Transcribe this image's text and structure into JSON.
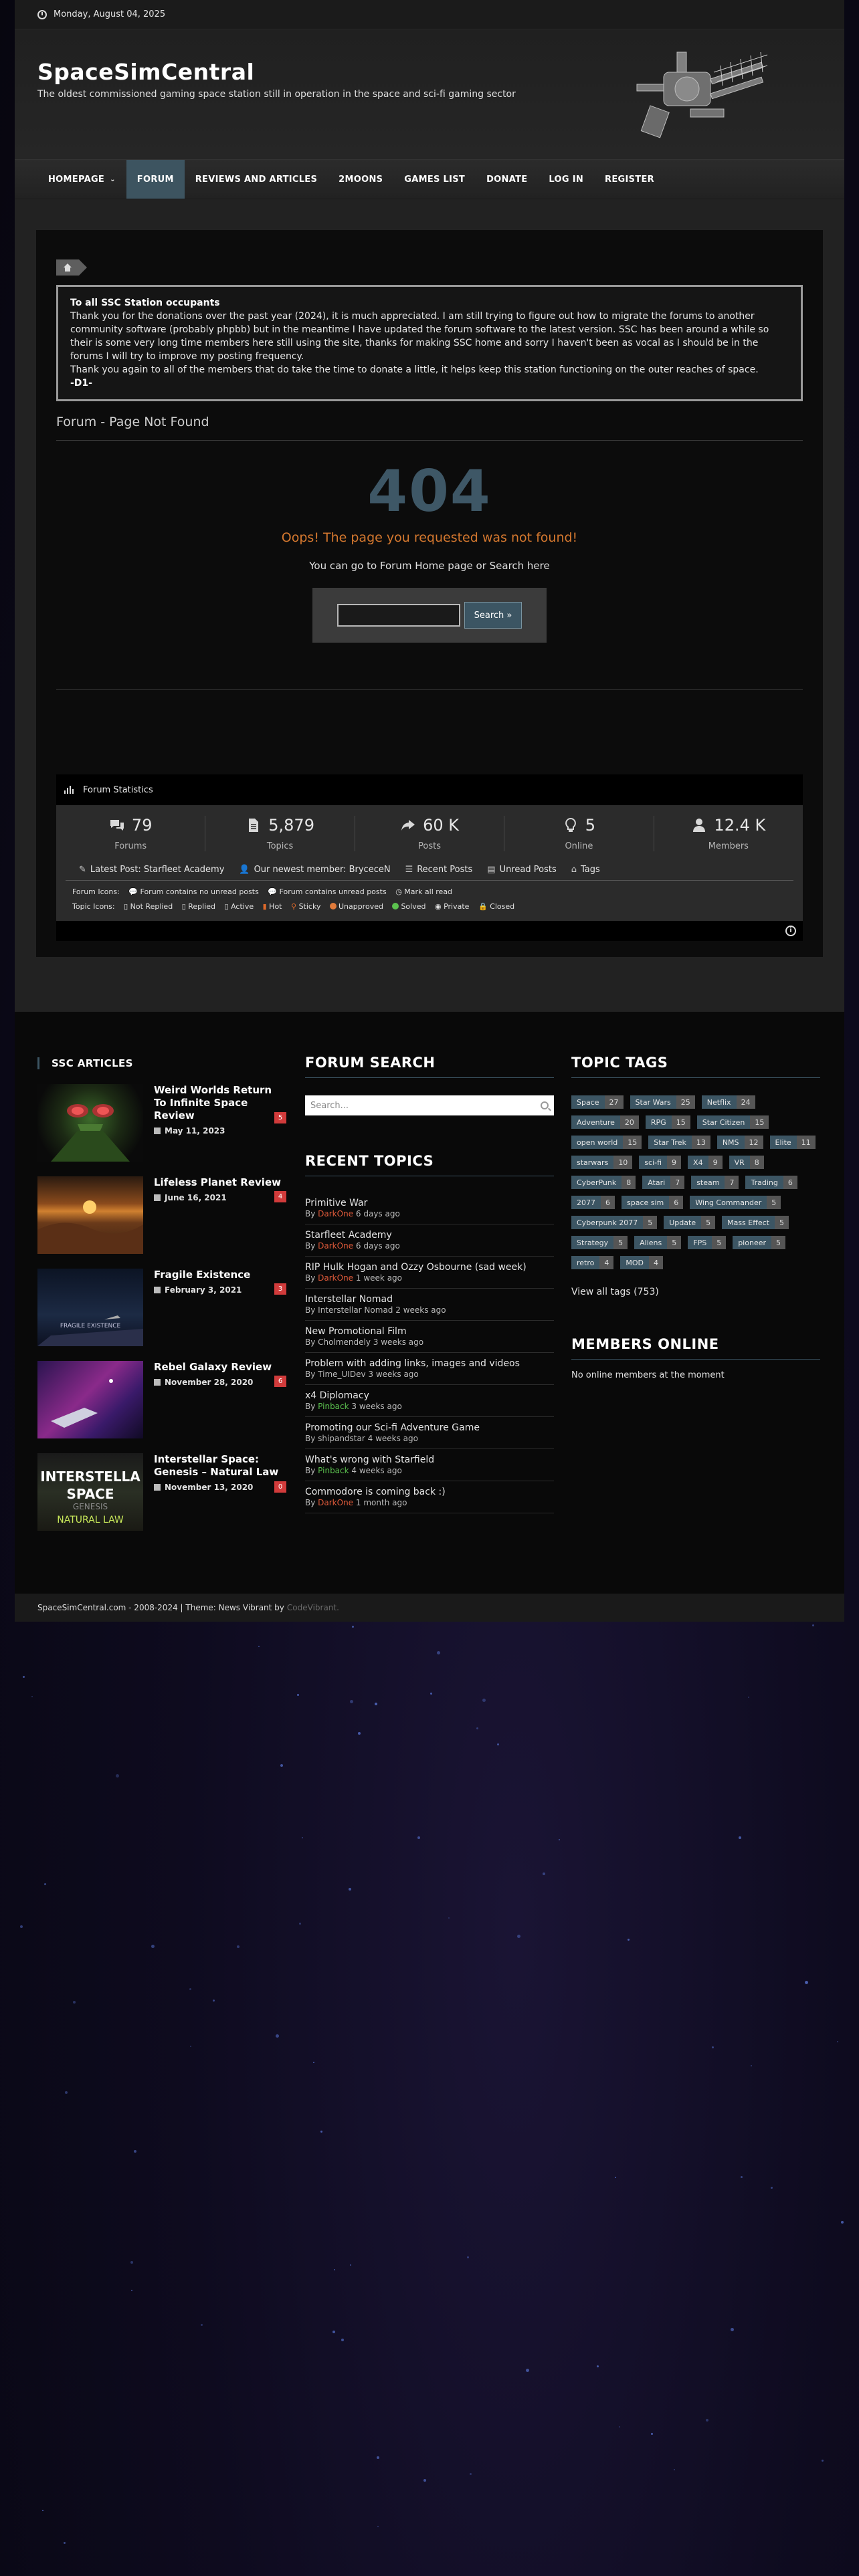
{
  "topbar": {
    "date": "Monday, August 04, 2025"
  },
  "header": {
    "title": "SpaceSimCentral",
    "tagline": "The oldest commissioned gaming space station still in operation in the space and sci-fi gaming sector"
  },
  "nav": {
    "items": [
      "HOMEPAGE",
      "FORUM",
      "REVIEWS AND ARTICLES",
      "2MOONS",
      "GAMES LIST",
      "DONATE",
      "LOG IN",
      "REGISTER"
    ]
  },
  "notice": {
    "heading": "To all SSC Station occupants",
    "body": "Thank you for the donations over the past year (2024), it is much appreciated. I am still trying to figure out how to migrate the forums to another community software (probably phpbb) but in the meantime I have updated the forum software to the latest version. SSC has been around a while so their is some very long time members here still using the site, thanks for making SSC home and sorry I haven't been as vocal as I should be in the forums I will try to improve my posting frequency.",
    "thanks": "Thank you again to all of the members that do take the time to donate a little, it helps keep this station functioning on the outer reaches of space.",
    "signature": "-D1-"
  },
  "not_found": {
    "heading": "Forum - Page Not Found",
    "code": "404",
    "oops": "Oops! The page you requested was not found!",
    "help": "You can go to Forum Home page or Search here",
    "search_button": "Search »"
  },
  "stats": {
    "title": "Forum Statistics",
    "items": [
      {
        "value": "79",
        "label": "Forums"
      },
      {
        "value": "5,879",
        "label": "Topics"
      },
      {
        "value": "60 K",
        "label": "Posts"
      },
      {
        "value": "5",
        "label": "Online"
      },
      {
        "value": "12.4 K",
        "label": "Members"
      }
    ],
    "latest_post": "Latest Post: Starfleet Academy",
    "newest_member": "Our newest member: BryceceN",
    "recent_posts": "Recent Posts",
    "unread_posts": "Unread Posts",
    "tags": "Tags",
    "forum_icons_label": "Forum Icons:",
    "forum_no_unread": "Forum contains no unread posts",
    "forum_unread": "Forum contains unread posts",
    "mark_all_read": "Mark all read",
    "topic_icons_label": "Topic Icons:",
    "topic_icons": [
      "Not Replied",
      "Replied",
      "Active",
      "Hot",
      "Sticky",
      "Unapproved",
      "Solved",
      "Private",
      "Closed"
    ]
  },
  "articles": {
    "title": "SSC ARTICLES",
    "items": [
      {
        "title": "Weird Worlds Return To Infinite Space Review",
        "date": "May 11, 2023",
        "count": "5"
      },
      {
        "title": "Lifeless Planet Review",
        "date": "June 16, 2021",
        "count": "4"
      },
      {
        "title": "Fragile Existence",
        "date": "February 3, 2021",
        "count": "3"
      },
      {
        "title": "Rebel Galaxy Review",
        "date": "November 28, 2020",
        "count": "6"
      },
      {
        "title": "Interstellar Space: Genesis – Natural Law",
        "date": "November 13, 2020",
        "count": "0"
      }
    ],
    "thumb_texts": {
      "fragile": "FRAGILE EXISTENCE",
      "interstellar_1": "INTERSTELLA",
      "interstellar_2": "SPACE",
      "interstellar_3": "GENESIS",
      "interstellar_4": "NATURAL LAW"
    }
  },
  "forum_search": {
    "title": "FORUM SEARCH",
    "placeholder": "Search..."
  },
  "recent_topics": {
    "title": "RECENT TOPICS",
    "items": [
      {
        "title": "Primitive War",
        "author": "DarkOne",
        "ago": "6 days ago",
        "color": "#e05a3a"
      },
      {
        "title": "Starfleet Academy",
        "author": "DarkOne",
        "ago": "6 days ago",
        "color": "#e05a3a"
      },
      {
        "title": "RIP Hulk Hogan and Ozzy Osbourne (sad week)",
        "author": "DarkOne",
        "ago": "1 week ago",
        "color": "#e05a3a"
      },
      {
        "title": "Interstellar Nomad",
        "author": "Interstellar Nomad",
        "ago": "2 weeks ago",
        "color": "#bbbbbb"
      },
      {
        "title": "New Promotional Film",
        "author": "Cholmendely",
        "ago": "3 weeks ago",
        "color": "#bbbbbb"
      },
      {
        "title": "Problem with adding links, images and videos",
        "author": "Time_UIDev",
        "ago": "3 weeks ago",
        "color": "#bbbbbb"
      },
      {
        "title": "x4 Diplomacy",
        "author": "Pinback",
        "ago": "3 weeks ago",
        "color": "#5cc24f"
      },
      {
        "title": "Promoting our Sci-fi Adventure Game",
        "author": "shipandstar",
        "ago": "4 weeks ago",
        "color": "#bbbbbb"
      },
      {
        "title": "What's wrong with Starfield",
        "author": "Pinback",
        "ago": "4 weeks ago",
        "color": "#5cc24f"
      },
      {
        "title": "Commodore is coming back :)",
        "author": "DarkOne",
        "ago": "1 month ago",
        "color": "#e05a3a"
      }
    ]
  },
  "topic_tags": {
    "title": "TOPIC TAGS",
    "items": [
      {
        "name": "Space",
        "count": "27"
      },
      {
        "name": "Star Wars",
        "count": "25"
      },
      {
        "name": "Netflix",
        "count": "24"
      },
      {
        "name": "Adventure",
        "count": "20"
      },
      {
        "name": "RPG",
        "count": "15"
      },
      {
        "name": "Star Citizen",
        "count": "15"
      },
      {
        "name": "open world",
        "count": "15"
      },
      {
        "name": "Star Trek",
        "count": "13"
      },
      {
        "name": "NMS",
        "count": "12"
      },
      {
        "name": "Elite",
        "count": "11"
      },
      {
        "name": "starwars",
        "count": "10"
      },
      {
        "name": "sci-fi",
        "count": "9"
      },
      {
        "name": "X4",
        "count": "9"
      },
      {
        "name": "VR",
        "count": "8"
      },
      {
        "name": "CyberPunk",
        "count": "8"
      },
      {
        "name": "Atari",
        "count": "7"
      },
      {
        "name": "steam",
        "count": "7"
      },
      {
        "name": "Trading",
        "count": "6"
      },
      {
        "name": "2077",
        "count": "6"
      },
      {
        "name": "space sim",
        "count": "6"
      },
      {
        "name": "Wing Commander",
        "count": "5"
      },
      {
        "name": "Cyberpunk 2077",
        "count": "5"
      },
      {
        "name": "Update",
        "count": "5"
      },
      {
        "name": "Mass Effect",
        "count": "5"
      },
      {
        "name": "Strategy",
        "count": "5"
      },
      {
        "name": "Aliens",
        "count": "5"
      },
      {
        "name": "FPS",
        "count": "5"
      },
      {
        "name": "pioneer",
        "count": "5"
      },
      {
        "name": "retro",
        "count": "4"
      },
      {
        "name": "MOD",
        "count": "4"
      }
    ],
    "view_all": "View all tags (753)"
  },
  "members_online": {
    "title": "MEMBERS ONLINE",
    "text": "No online members at the moment"
  },
  "footer": {
    "copyright": "SpaceSimCentral.com - 2008-2024 | Theme: News Vibrant by",
    "credit": "CodeVibrant."
  },
  "colors": {
    "accent": "#3c5563",
    "badge_red": "#d13b3b",
    "orange": "#d5782f",
    "code404": "#3e5766"
  }
}
